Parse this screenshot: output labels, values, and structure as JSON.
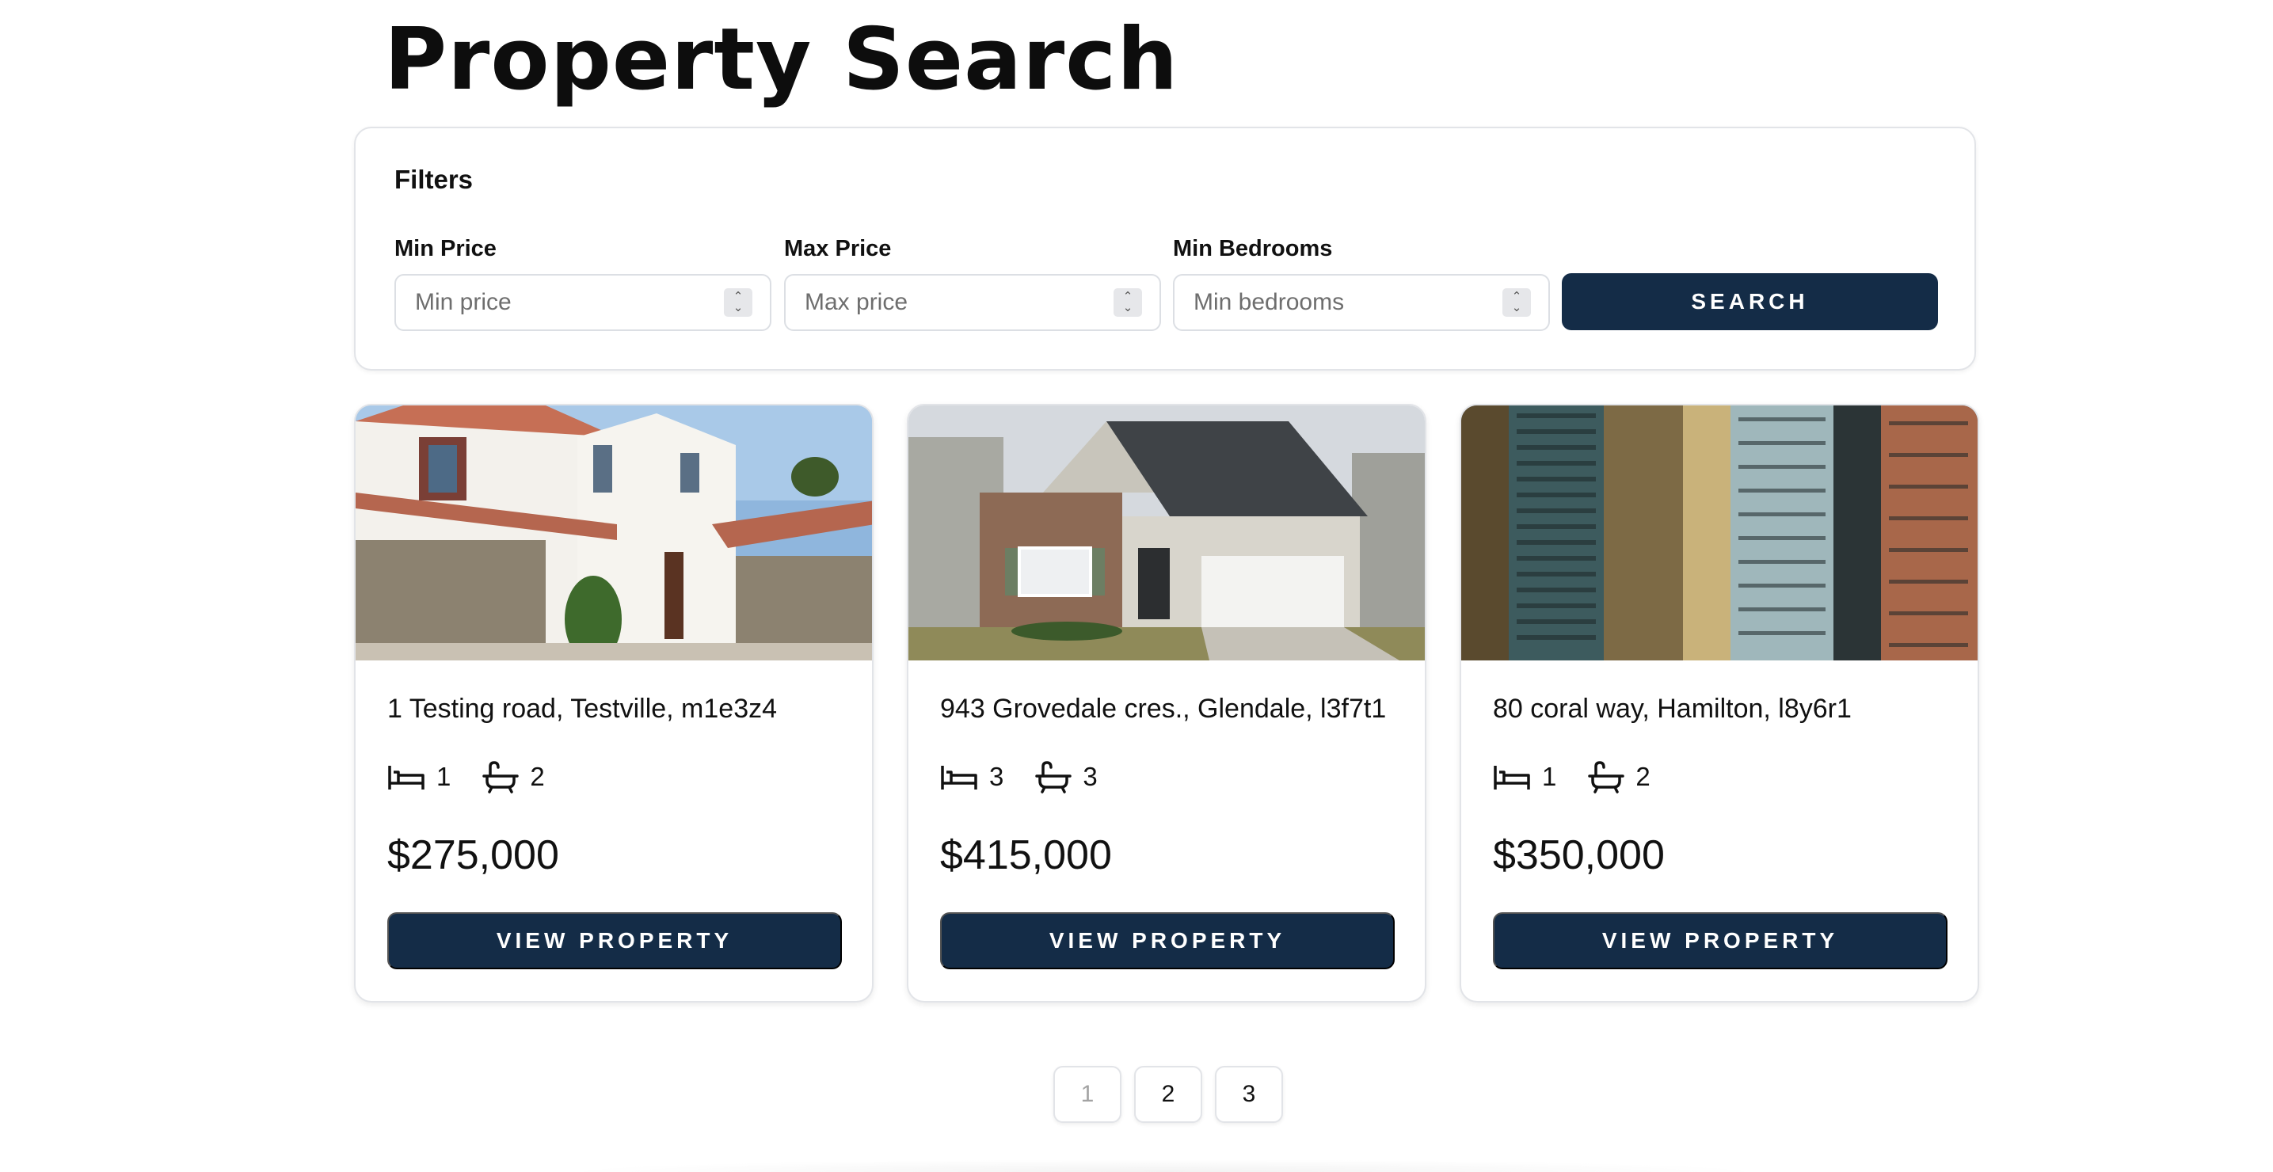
{
  "page": {
    "title": "Property Search"
  },
  "filters": {
    "heading": "Filters",
    "fields": [
      {
        "label": "Min Price",
        "placeholder": "Min price"
      },
      {
        "label": "Max Price",
        "placeholder": "Max price"
      },
      {
        "label": "Min Bedrooms",
        "placeholder": "Min bedrooms"
      }
    ],
    "search_label": "SEARCH"
  },
  "listings": [
    {
      "address": "1 Testing road, Testville, m1e3z4",
      "bedrooms": "1",
      "bathrooms": "2",
      "price": "$275,000",
      "button_label": "VIEW PROPERTY"
    },
    {
      "address": "943 Grovedale cres., Glendale, l3f7t1",
      "bedrooms": "3",
      "bathrooms": "3",
      "price": "$415,000",
      "button_label": "VIEW PROPERTY"
    },
    {
      "address": "80 coral way, Hamilton, l8y6r1",
      "bedrooms": "1",
      "bathrooms": "2",
      "price": "$350,000",
      "button_label": "VIEW PROPERTY"
    }
  ],
  "pagination": {
    "pages": [
      "1",
      "2",
      "3"
    ],
    "current": "1"
  },
  "icons": {
    "bed": "bed-icon",
    "bath": "bathtub-icon",
    "spinner": "number-spinner-icon"
  },
  "colors": {
    "primary": "#142c47",
    "border": "#e2e4e8",
    "text": "#111111",
    "muted": "#6e6e6e"
  }
}
